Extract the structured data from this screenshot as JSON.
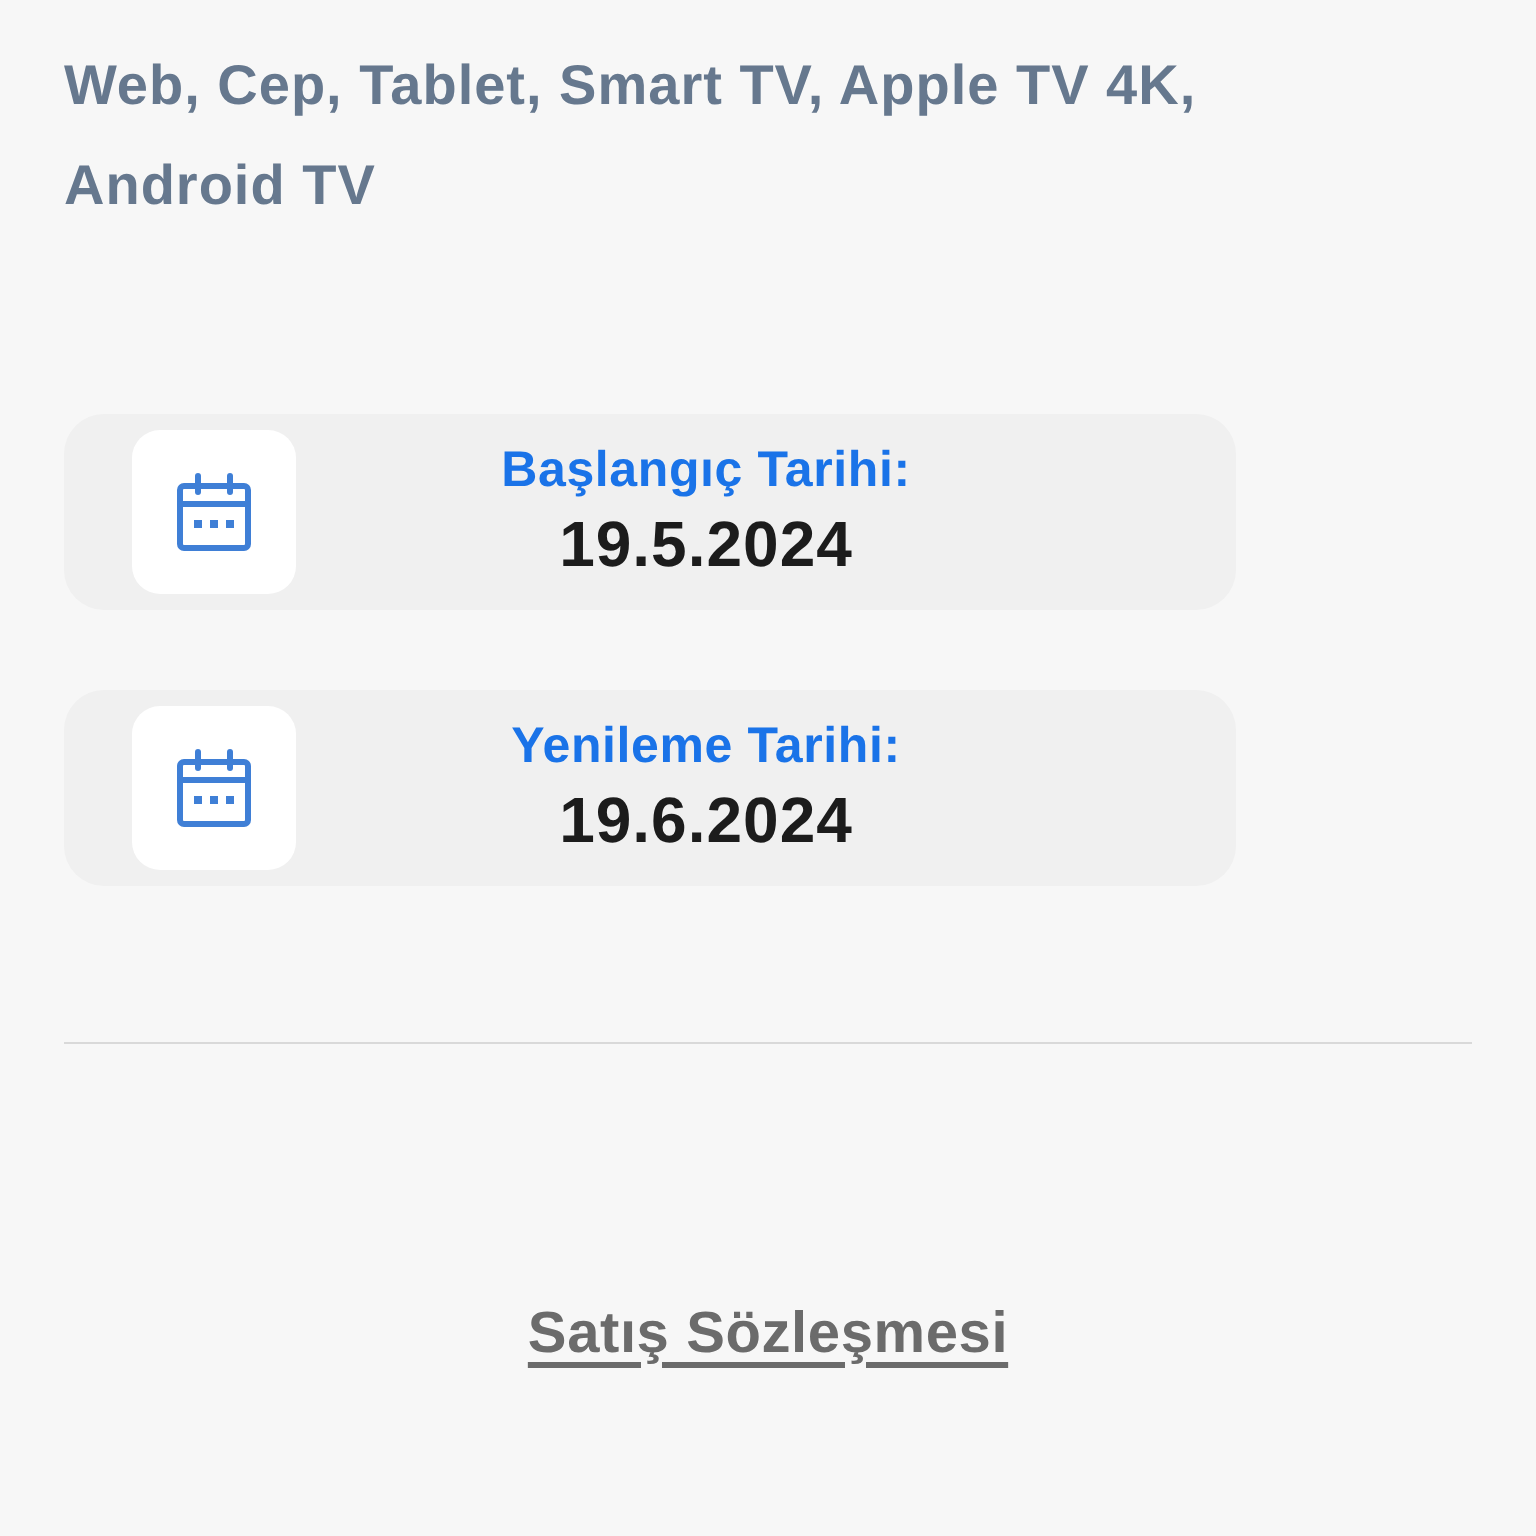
{
  "platforms_text": "Web, Cep, Tablet, Smart TV, Apple TV 4K, Android TV",
  "dates": [
    {
      "label": "Başlangıç Tarihi:",
      "value": "19.5.2024"
    },
    {
      "label": "Yenileme Tarihi:",
      "value": "19.6.2024"
    }
  ],
  "contract_link": "Satış Sözleşmesi"
}
